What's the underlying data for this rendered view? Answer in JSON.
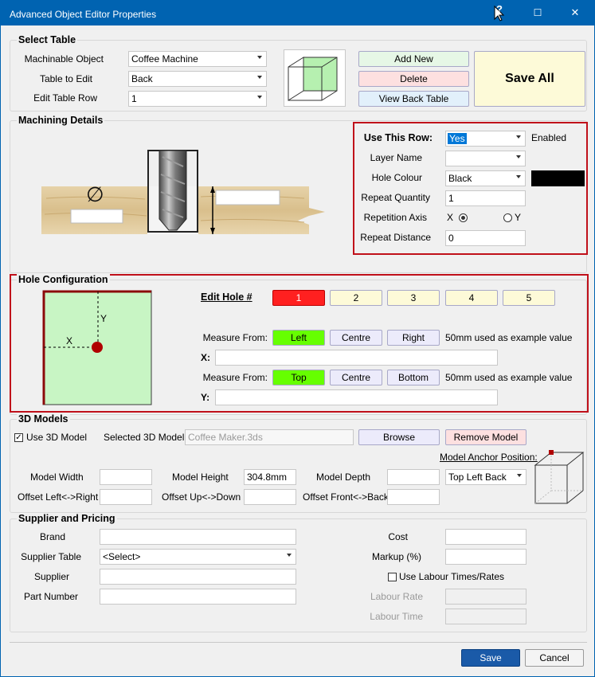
{
  "window": {
    "title": "Advanced Object Editor Properties",
    "help_glyph": "?",
    "maximize_glyph": "☐",
    "close_glyph": "✕"
  },
  "select_table": {
    "title": "Select Table",
    "machinable_object_label": "Machinable Object",
    "machinable_object_value": "Coffee Machine",
    "table_to_edit_label": "Table to Edit",
    "table_to_edit_value": "Back",
    "edit_table_row_label": "Edit Table Row",
    "edit_table_row_value": "1",
    "add_new": "Add New",
    "delete": "Delete",
    "view_back_table": "View Back Table",
    "save_all": "Save All"
  },
  "machining": {
    "title": "Machining Details",
    "diameter_symbol": "∅",
    "use_this_row_label": "Use This Row:",
    "use_this_row_value": "Yes",
    "enabled_text": "Enabled",
    "layer_name_label": "Layer Name",
    "layer_name_value": "",
    "hole_colour_label": "Hole Colour",
    "hole_colour_value": "Black",
    "hole_colour_swatch": "#000000",
    "repeat_quantity_label": "Repeat Quantity",
    "repeat_quantity_value": "1",
    "repetition_axis_label": "Repetition Axis",
    "axis_x": "X",
    "axis_y": "Y",
    "repeat_distance_label": "Repeat Distance",
    "repeat_distance_value": "0"
  },
  "hole_config": {
    "title": "Hole Configuration",
    "diagram_x": "X",
    "diagram_y": "Y",
    "edit_hole_label": "Edit Hole #",
    "holes": [
      "1",
      "2",
      "3",
      "4",
      "5"
    ],
    "active_hole_color": "#ff2020",
    "measure_from_label": "Measure From:",
    "x_label": "X:",
    "y_label": "Y:",
    "x_value": "",
    "y_value": "",
    "x_buttons": [
      "Left",
      "Centre",
      "Right"
    ],
    "y_buttons": [
      "Top",
      "Centre",
      "Bottom"
    ],
    "hint": "50mm used as example value",
    "active_color": "#66ff00"
  },
  "models": {
    "title": "3D Models",
    "use_3d_model_label": "Use 3D Model",
    "use_3d_model_checked": "✓",
    "selected_model_label": "Selected 3D Model",
    "selected_model_value": "Coffee Maker.3ds",
    "browse": "Browse",
    "remove_model": "Remove Model",
    "anchor_label": "Model Anchor Position:",
    "anchor_value": "Top Left Back",
    "model_width_label": "Model Width",
    "model_width_value": "",
    "model_height_label": "Model Height",
    "model_height_value": "304.8mm",
    "model_depth_label": "Model Depth",
    "model_depth_value": "",
    "offset_lr_label": "Offset Left<->Right",
    "offset_lr_value": "",
    "offset_ud_label": "Offset Up<->Down",
    "offset_ud_value": "",
    "offset_fb_label": "Offset Front<->Back",
    "offset_fb_value": ""
  },
  "supplier": {
    "title": "Supplier and Pricing",
    "brand_label": "Brand",
    "brand_value": "",
    "supplier_table_label": "Supplier Table",
    "supplier_table_value": "<Select>",
    "supplier_label": "Supplier",
    "supplier_value": "",
    "part_number_label": "Part Number",
    "part_number_value": "",
    "cost_label": "Cost",
    "cost_value": "",
    "markup_label": "Markup (%)",
    "markup_value": "",
    "use_labour_label": "Use Labour Times/Rates",
    "labour_rate_label": "Labour Rate",
    "labour_rate_value": "",
    "labour_time_label": "Labour Time",
    "labour_time_value": ""
  },
  "footer": {
    "save": "Save",
    "cancel": "Cancel"
  },
  "colors": {
    "title_bar": "#0063b1",
    "green_button": "#e6f7e6",
    "red_button": "#fde0e0",
    "blue_button": "#e2f0fb",
    "yellow_button": "#fdfad8",
    "lavender_button": "#ecebfb",
    "highlight_border": "#c0101a"
  }
}
